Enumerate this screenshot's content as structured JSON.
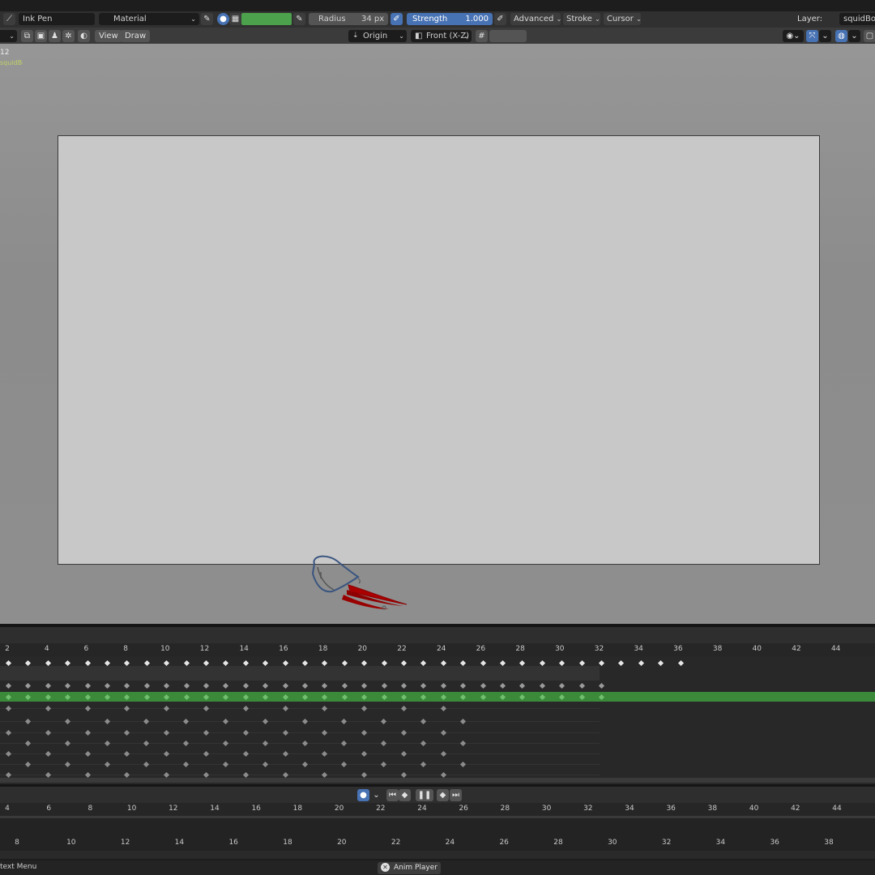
{
  "header": {
    "brush_name": "Ink Pen",
    "material_label": "Material",
    "radius_label": "Radius",
    "radius_value": "34 px",
    "strength_label": "Strength",
    "strength_value": "1.000",
    "menus": [
      "Advanced",
      "Stroke",
      "Cursor"
    ],
    "layer_label": "Layer:",
    "layer_value": "squidBod",
    "color_swatch": "#4ca14c",
    "accent": "#4772b3"
  },
  "viewport_header": {
    "view_label": "View",
    "draw_label": "Draw",
    "origin_label": "Origin",
    "view_axis_label": "Front (X-Z)"
  },
  "viewport": {
    "frame_number": "12",
    "object_name": "squidBod",
    "canvas_color": "#c8c8c8"
  },
  "dopesheet": {
    "ruler_labels": [
      "2",
      "4",
      "6",
      "8",
      "10",
      "12",
      "14",
      "16",
      "18",
      "20",
      "22",
      "24",
      "26",
      "28",
      "30",
      "32",
      "34",
      "36",
      "38",
      "40",
      "42",
      "44"
    ],
    "active_row_color": "#3a8a3a"
  },
  "playback": {
    "ruler_labels": [
      "4",
      "6",
      "8",
      "10",
      "12",
      "14",
      "16",
      "18",
      "20",
      "22",
      "24",
      "26",
      "28",
      "30",
      "32",
      "34",
      "36",
      "38",
      "40",
      "42",
      "44"
    ]
  },
  "lower_ruler": {
    "labels": [
      "8",
      "10",
      "12",
      "14",
      "16",
      "18",
      "20",
      "22",
      "24",
      "26",
      "28",
      "30",
      "32",
      "34",
      "36",
      "38"
    ]
  },
  "status": {
    "context_menu": "text Menu",
    "anim_player": "Anim Player"
  }
}
